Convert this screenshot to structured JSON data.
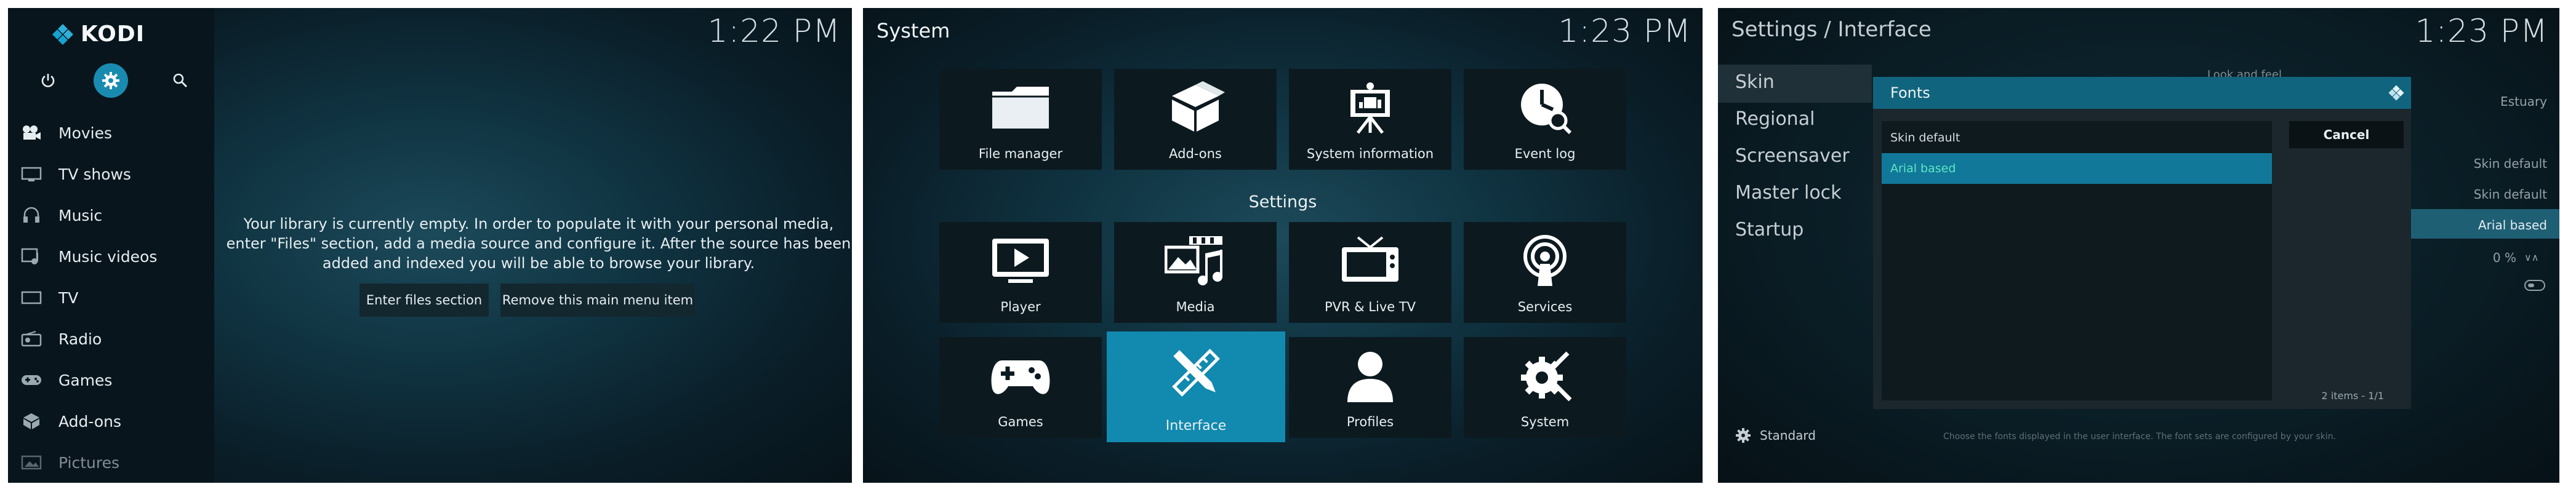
{
  "colors": {
    "accent": "#1289ae",
    "dialog_header": "#11647d",
    "highlight": "#1e5f74"
  },
  "home": {
    "app_name": "KODI",
    "clock": "1:22 PM",
    "top_icons": [
      "power-icon",
      "gear-icon",
      "search-icon"
    ],
    "menu": [
      {
        "label": "Movies",
        "icon": "movies-icon"
      },
      {
        "label": "TV shows",
        "icon": "tv-shows-icon"
      },
      {
        "label": "Music",
        "icon": "music-icon"
      },
      {
        "label": "Music videos",
        "icon": "music-videos-icon"
      },
      {
        "label": "TV",
        "icon": "tv-icon"
      },
      {
        "label": "Radio",
        "icon": "radio-icon"
      },
      {
        "label": "Games",
        "icon": "games-icon"
      },
      {
        "label": "Add-ons",
        "icon": "addons-icon"
      },
      {
        "label": "Pictures",
        "icon": "pictures-icon"
      }
    ],
    "message": "Your library is currently empty. In order to populate it with your personal media, enter \"Files\" section, add a media source and configure it. After the source has been added and indexed you will be able to browse your library.",
    "buttons": {
      "enter_files": "Enter files section",
      "remove_item": "Remove this main menu item"
    }
  },
  "system": {
    "title": "System",
    "clock": "1:23 PM",
    "settings_heading": "Settings",
    "tiles": [
      {
        "label": "File manager",
        "icon": "folder-icon"
      },
      {
        "label": "Add-ons",
        "icon": "addons-box-icon"
      },
      {
        "label": "System information",
        "icon": "system-info-icon"
      },
      {
        "label": "Event log",
        "icon": "event-log-icon"
      },
      {
        "label": "Player",
        "icon": "player-icon"
      },
      {
        "label": "Media",
        "icon": "media-icon"
      },
      {
        "label": "PVR & Live TV",
        "icon": "pvr-tv-icon"
      },
      {
        "label": "Services",
        "icon": "services-icon"
      },
      {
        "label": "Games",
        "icon": "gamepad-icon"
      },
      {
        "label": "Interface",
        "icon": "interface-icon"
      },
      {
        "label": "Profiles",
        "icon": "profiles-icon"
      },
      {
        "label": "System",
        "icon": "system-gear-icon"
      }
    ]
  },
  "interface": {
    "title": "Settings / Interface",
    "clock": "1:23 PM",
    "categories": [
      "Skin",
      "Regional",
      "Screensaver",
      "Master lock",
      "Startup"
    ],
    "section_header": "Look and feel",
    "right_values": [
      "Estuary",
      "Skin default",
      "Skin default",
      "Arial based",
      "0 %"
    ],
    "level": "Standard",
    "hint": "Choose the fonts displayed in the user interface. The font sets are configured by your skin.",
    "dialog": {
      "title": "Fonts",
      "items": [
        "Skin default",
        "Arial based"
      ],
      "cancel": "Cancel",
      "count": "2 items - 1/1"
    }
  }
}
